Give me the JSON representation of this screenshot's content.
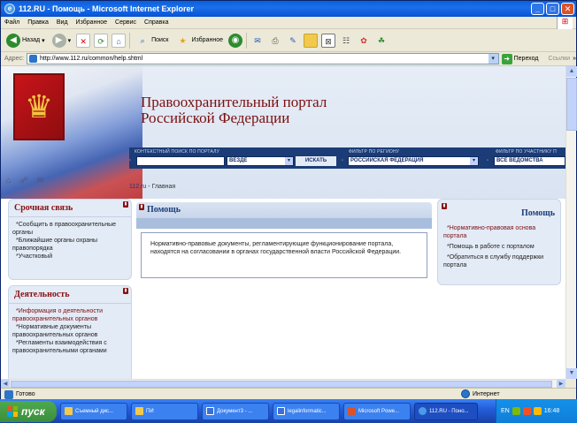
{
  "window": {
    "title": "112.RU - Помощь - Microsoft Internet Explorer",
    "ie_icon": "ie-icon",
    "buttons": [
      "_",
      "□",
      "✕"
    ]
  },
  "menu": [
    "Файл",
    "Правка",
    "Вид",
    "Избранное",
    "Сервис",
    "Справка"
  ],
  "toolbar": {
    "back_label": "Назад",
    "search_label": "Поиск",
    "favorites_label": "Избранное"
  },
  "address": {
    "label": "Адрес:",
    "url": "http://www.112.ru/common/help.shtml",
    "go_label": "Переход",
    "links_label": "Ссылки"
  },
  "banner": {
    "title_line1": "Правоохранительный портал",
    "title_line2": "Российской Федерации",
    "context_search_label": "КОНТЕКСТНЫЙ ПОИСК ПО ПОРТАЛУ",
    "scope_value": "ВЕЗДЕ",
    "search_button": "ИСКАТЬ",
    "region_filter_label": "ФИЛЬТР ПО РЕГИОНУ",
    "region_value": "РОССИЙСКАЯ ФЕДЕРАЦИЯ",
    "participant_filter_label": "ФИЛЬТР ПО УЧАСТНИКУ П",
    "participant_value": "ВСЕ ВЕДОМСТВА"
  },
  "breadcrumb": {
    "home": "112.ru",
    "separator": " - ",
    "current": "Главная"
  },
  "left": {
    "urgent": {
      "title": "Срочная связь",
      "items": [
        "*Сообщить в правоохранительные органы",
        "*Ближайшие органы охраны правопорядка",
        "*Участковый"
      ]
    },
    "activity": {
      "title": "Деятельность",
      "items": [
        "*Информация о деятельности правоохранительных органов",
        "*Нормативные документы правоохранительных органов",
        "*Регламенты взаимодействия с правоохранительными органами"
      ]
    }
  },
  "center": {
    "title": "Помощь",
    "text": "Нормативно-правовые документы, регламентирующие функционирование портала, находятся на согласовании в органах государственной власти Российской Федерации."
  },
  "right": {
    "title": "Помощь",
    "items": [
      "*Нормативно-правовая основа портала",
      "*Помощь в работе с порталом",
      "*Обратиться в службу поддержки портала"
    ]
  },
  "status": {
    "left": "Готово",
    "zone": "Интернет"
  },
  "taskbar": {
    "start": "пуск",
    "tasks": [
      {
        "label": "Съемный дис...",
        "color": "#f2c94c"
      },
      {
        "label": "ПИ",
        "color": "#f2c94c"
      },
      {
        "label": "Документ3 - ...",
        "color": "#3b6fd6"
      },
      {
        "label": "legalinformatic...",
        "color": "#3b6fd6"
      },
      {
        "label": "Microsoft Powe...",
        "color": "#d9532c"
      },
      {
        "label": "112.RU - Поно...",
        "color": "#4a9be8"
      }
    ],
    "lang": "EN",
    "time": "16:48"
  }
}
